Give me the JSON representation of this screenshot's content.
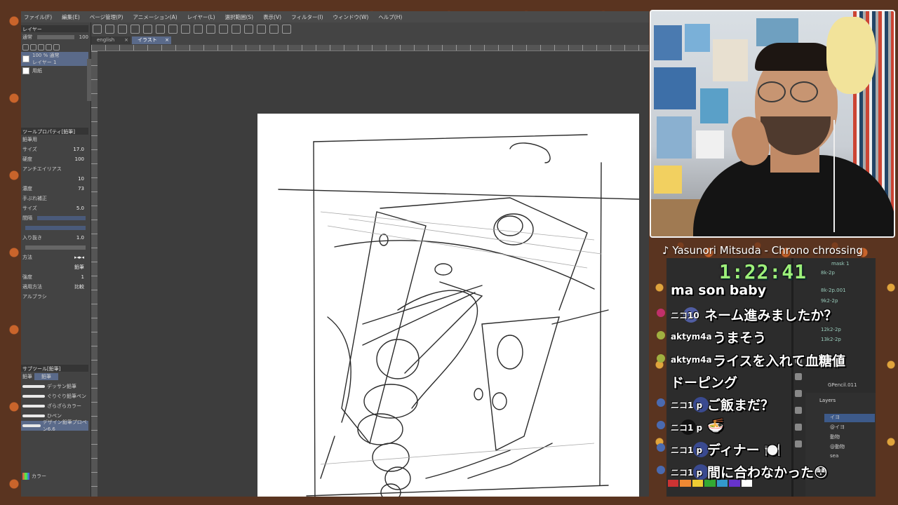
{
  "menu": [
    "ファイル(F)",
    "編集(E)",
    "ページ管理(P)",
    "アニメーション(A)",
    "レイヤー(L)",
    "選択範囲(S)",
    "表示(V)",
    "フィルター(I)",
    "ウィンドウ(W)",
    "ヘルプ(H)"
  ],
  "doc_tabs": [
    {
      "label": "english",
      "active": false
    },
    {
      "label": "イラスト",
      "active": true
    }
  ],
  "layer_panel": {
    "blend_mode": "通常",
    "opacity": "100",
    "layers": [
      {
        "label": "100 % 通常",
        "sub": "レイヤー 1",
        "selected": true
      },
      {
        "label": "用紙",
        "selected": false
      }
    ]
  },
  "tool_property": {
    "title": "ツールプロパティ[鉛筆]",
    "brush_name": "鉛筆用",
    "rows": [
      {
        "label": "サイズ",
        "value": "17.0"
      },
      {
        "label": "硬度",
        "value": "100"
      },
      {
        "label": "アンチエイリアス",
        "value": ""
      },
      {
        "label": "",
        "value": "10"
      },
      {
        "label": "濃度",
        "value": "73"
      },
      {
        "label": "手ぶれ補正",
        "value": ""
      },
      {
        "label": "サイズ",
        "value": "5.0"
      },
      {
        "label": "間隔",
        "value": ""
      },
      {
        "label": "",
        "value": ""
      },
      {
        "label": "入り抜き",
        "value": "1.0"
      },
      {
        "label": "",
        "value": ""
      },
      {
        "label": "方法",
        "value": ""
      },
      {
        "label": "",
        "value": "鉛筆"
      },
      {
        "label": "強度",
        "value": "1"
      },
      {
        "label": "適用方法",
        "value": "比較"
      },
      {
        "label": "アルブラシ",
        "value": ""
      }
    ]
  },
  "sub_tool": {
    "title": "サブツール[鉛筆]",
    "tabs": [
      "鉛筆",
      "鉛筆"
    ],
    "brushes": [
      "デッサン鉛筆",
      "ぐりぐり鉛筆ペン",
      "ざらざらカラー",
      "ひペン",
      "デザイン鉛筆プロペン6.6"
    ]
  },
  "color_panel": {
    "title": "カラー"
  },
  "music": "♪ Yasunori Mitsuda - Chrono chrossing",
  "timer": "1:22:41",
  "chat": [
    {
      "user": "",
      "message": "ma son baby",
      "badge": "",
      "avatar": false
    },
    {
      "user": "ニコ10",
      "message": "ネーム進みましたか？",
      "badge": "#c0306a",
      "avatar": true
    },
    {
      "user": "aktym4a",
      "message": "うまそう",
      "badge": "#a0b040",
      "avatar": false
    },
    {
      "user": "aktym4a",
      "message": "ライスを入れて血糖値",
      "badge": "#a0b040",
      "avatar": false
    },
    {
      "user": "",
      "message": "ドーピング",
      "badge": "",
      "avatar": false
    },
    {
      "user": "ニコ1 p",
      "message": "ご飯まだ？",
      "badge": "#4a6ab0",
      "avatar": true
    },
    {
      "user": "ニコ1 p",
      "message": "🍜",
      "badge": "#4a6ab0",
      "avatar": true
    },
    {
      "user": "ニコ1 p",
      "message": "ディナー 🍽️",
      "badge": "#4a6ab0",
      "avatar": true
    },
    {
      "user": "ニコ1 p",
      "message": "間に合わなかった😳",
      "badge": "#4a6ab0",
      "avatar": true
    }
  ],
  "blender": {
    "gpencil": "GPencil.011",
    "layers_title": "Layers",
    "layers": [
      "イヨ",
      "@イヨ",
      "動物",
      "@動物",
      "sea"
    ],
    "outliner": [
      "8k-2p",
      "8k-2p.001",
      "9k2-2p",
      "12k2-2p",
      "13k2-2p",
      "mask 1"
    ]
  },
  "colors": {
    "accent": "#5a6a8a",
    "timer": "#9df07a",
    "chat_text": "#ffffff"
  }
}
